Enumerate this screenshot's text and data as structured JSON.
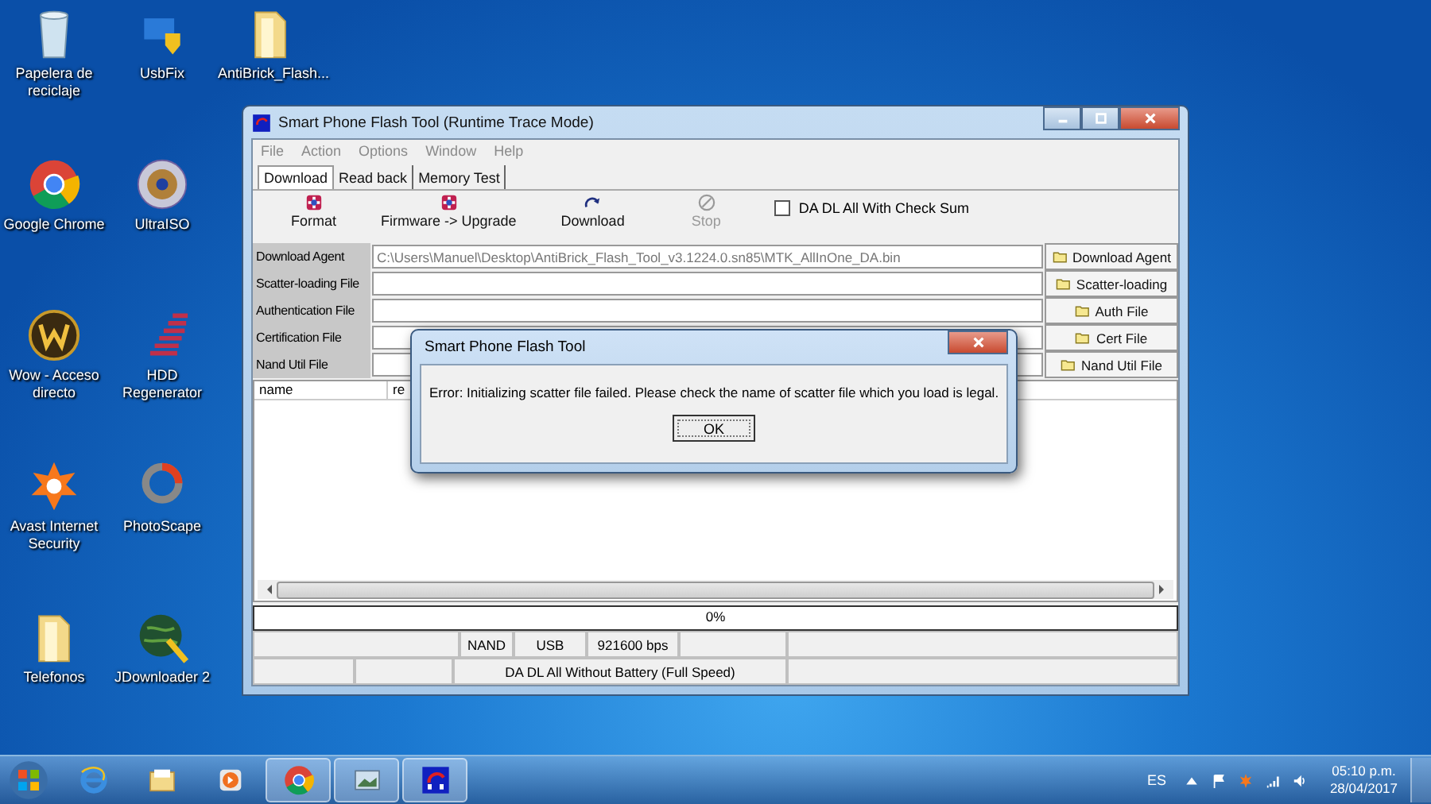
{
  "desktop_icons": [
    {
      "label": "Papelera de reciclaje",
      "kind": "recycle"
    },
    {
      "label": "Google Chrome",
      "kind": "chrome"
    },
    {
      "label": "Wow - Acceso directo",
      "kind": "wow"
    },
    {
      "label": "Avast Internet Security",
      "kind": "avast"
    },
    {
      "label": "Telefonos",
      "kind": "folder"
    },
    {
      "label": "UsbFix",
      "kind": "usb"
    },
    {
      "label": "UltraISO",
      "kind": "disc"
    },
    {
      "label": "HDD Regenerator",
      "kind": "bars"
    },
    {
      "label": "PhotoScape",
      "kind": "ring"
    },
    {
      "label": "JDownloader 2",
      "kind": "globe"
    },
    {
      "label": "AntiBrick_Flash...",
      "kind": "folder"
    }
  ],
  "window": {
    "title": "Smart Phone Flash Tool (Runtime Trace Mode)",
    "menu": [
      {
        "label": "File",
        "disabled": true
      },
      {
        "label": "Action",
        "disabled": true
      },
      {
        "label": "Options",
        "disabled": true
      },
      {
        "label": "Window",
        "disabled": true
      },
      {
        "label": "Help",
        "disabled": true
      }
    ],
    "tabs": [
      {
        "label": "Download",
        "selected": true
      },
      {
        "label": "Read back",
        "selected": false
      },
      {
        "label": "Memory Test",
        "selected": false
      }
    ],
    "toolbar": [
      {
        "label": "Format",
        "kind": "gem",
        "disabled": false
      },
      {
        "label": "Firmware -> Upgrade",
        "kind": "gem",
        "disabled": false
      },
      {
        "label": "Download",
        "kind": "arrow",
        "disabled": false
      },
      {
        "label": "Stop",
        "kind": "stop",
        "disabled": true
      }
    ],
    "checksum": {
      "label": "DA DL All With Check Sum",
      "checked": false
    },
    "file_rows": [
      {
        "label": "Download Agent",
        "value": "C:\\Users\\Manuel\\Desktop\\AntiBrick_Flash_Tool_v3.1224.0.sn85\\MTK_AllInOne_DA.bin",
        "button": "Download Agent"
      },
      {
        "label": "Scatter-loading File",
        "button": "Scatter-loading"
      },
      {
        "label": "Authentication File",
        "button": "Auth File"
      },
      {
        "label": "Certification File",
        "button": "Cert File"
      },
      {
        "label": "Nand Util File",
        "button": "Nand Util File"
      }
    ],
    "table": {
      "columns": [
        "name",
        "re"
      ]
    },
    "progress": {
      "text": "0%",
      "level": 0
    },
    "status_bar": {
      "row_1": [
        "NAND",
        "USB",
        "921600 bps"
      ],
      "row_2": [
        "DA DL All Without Battery (Full Speed)"
      ]
    }
  },
  "dialog": {
    "title": "Smart Phone Flash Tool",
    "message": "Error: Initializing scatter file failed. Please check the name of scatter file which you load is legal.",
    "button": "OK"
  },
  "taskbar": {
    "items": [
      {
        "kind": "ie",
        "active": false
      },
      {
        "kind": "explorer",
        "active": false
      },
      {
        "kind": "media",
        "active": false
      },
      {
        "kind": "chrome",
        "active": true
      },
      {
        "kind": "photos",
        "active": true
      },
      {
        "kind": "flashtool",
        "active": true
      }
    ],
    "language": "ES",
    "time": "05:10 p.m.",
    "date": "28/04/2017"
  }
}
